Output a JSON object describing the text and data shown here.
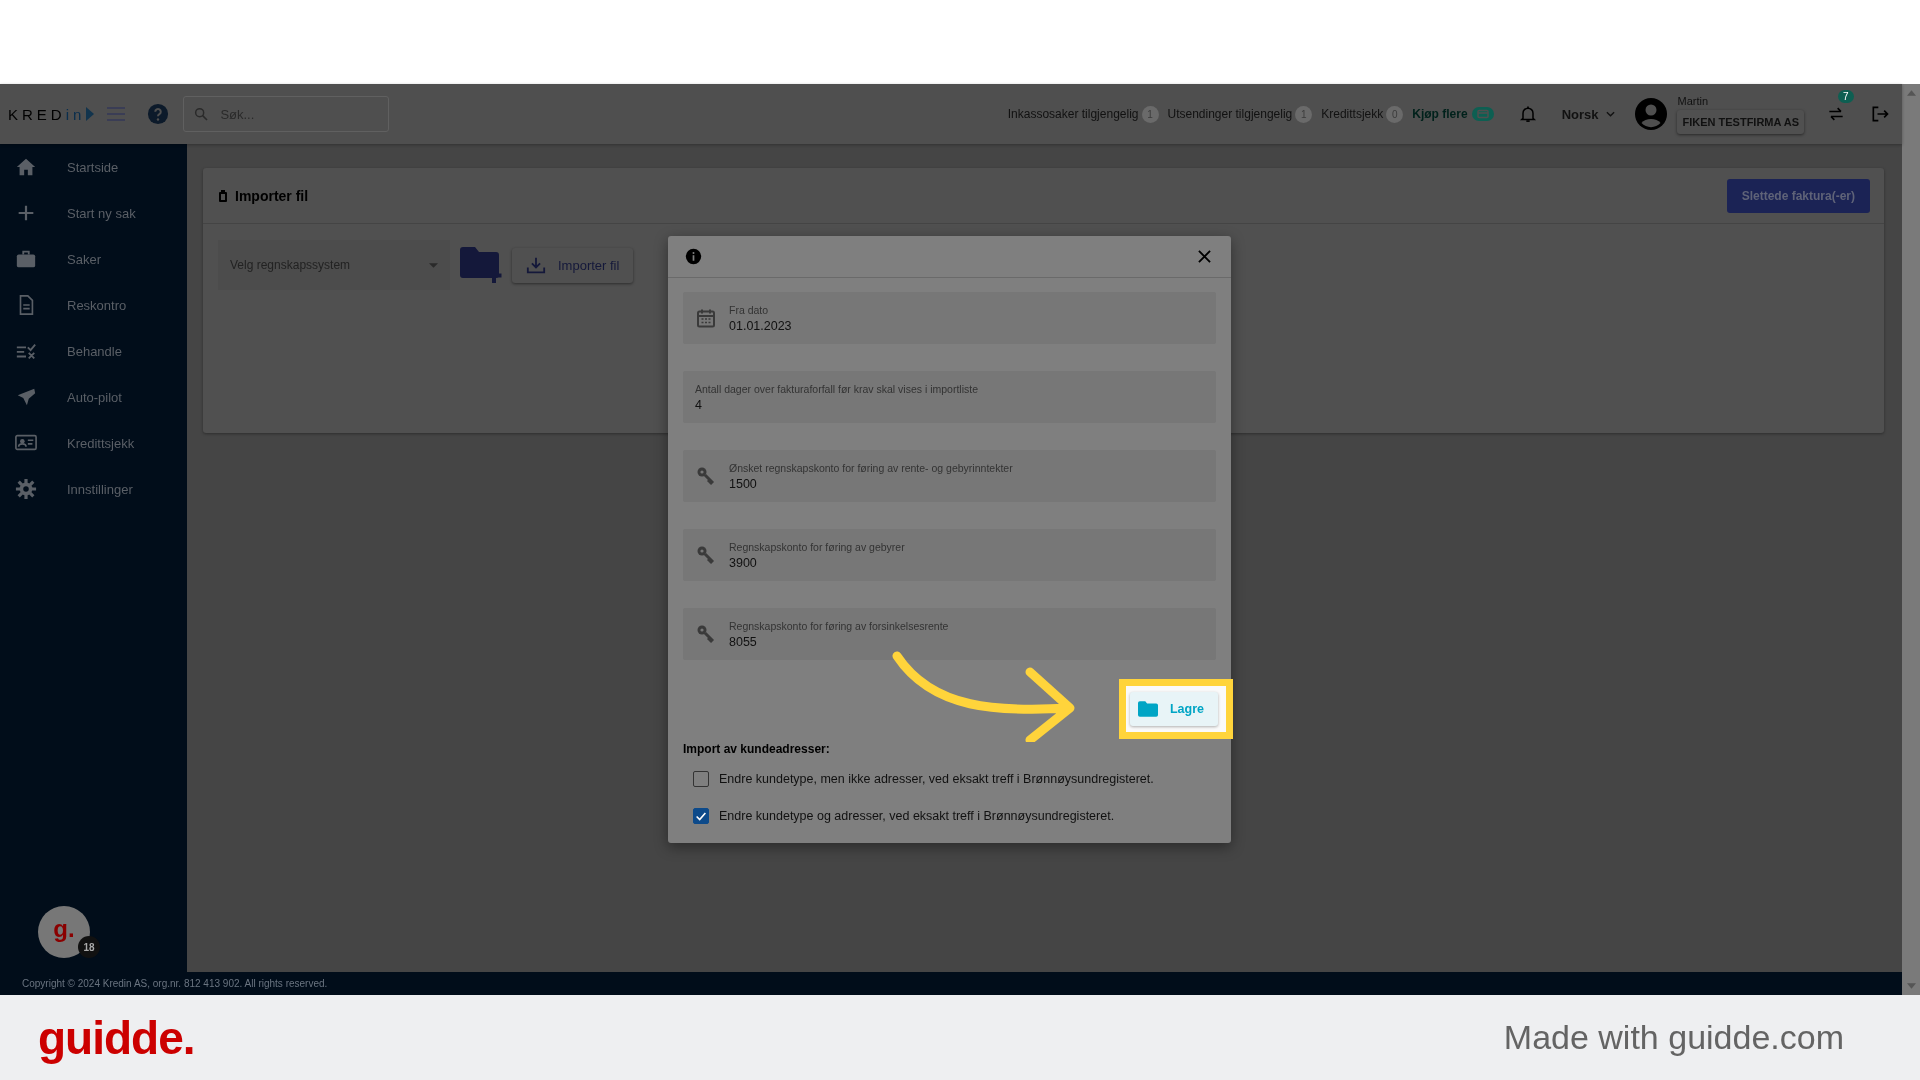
{
  "logo": {
    "text_1": "KRED",
    "text_2": "in"
  },
  "search": {
    "placeholder": "Søk..."
  },
  "counters": [
    {
      "label": "Inkassosaker tilgjengelig",
      "count": "1"
    },
    {
      "label": "Utsendinger tilgjengelig",
      "count": "1"
    },
    {
      "label": "Kredittsjekk",
      "count": "0"
    }
  ],
  "buy_link": "Kjøp flere",
  "language": "Norsk",
  "user": {
    "name": "Martin",
    "company": "FIKEN TESTFIRMA AS"
  },
  "switch_badge": "7",
  "sidebar": {
    "items": [
      {
        "label": "Startside"
      },
      {
        "label": "Start ny sak"
      },
      {
        "label": "Saker"
      },
      {
        "label": "Reskontro"
      },
      {
        "label": "Behandle"
      },
      {
        "label": "Auto-pilot"
      },
      {
        "label": "Kredittsjekk"
      },
      {
        "label": "Innstillinger"
      }
    ]
  },
  "assistant": {
    "initial": "g.",
    "count": "18"
  },
  "page": {
    "title": "Importer fil",
    "deleted_button": "Slettede faktura(-er)",
    "select": {
      "placeholder": "Velg regnskapssystem"
    },
    "import_button": "Importer fil"
  },
  "dialog": {
    "fields": [
      {
        "kind": "date",
        "label": "Fra dato",
        "value": "01.01.2023"
      },
      {
        "kind": "plain",
        "label": "Antall dager over fakturaforfall før krav skal vises i importliste",
        "value": "4"
      },
      {
        "kind": "account",
        "label": "Ønsket regnskapskonto for føring av rente- og gebyrinntekter",
        "value": "1500"
      },
      {
        "kind": "account",
        "label": "Regnskapskonto for føring av gebyrer",
        "value": "3900"
      },
      {
        "kind": "account",
        "label": "Regnskapskonto for føring av forsinkelsesrente",
        "value": "8055"
      }
    ],
    "save_button": "Lagre",
    "section_title": "Import av kundeadresser:",
    "options": [
      {
        "label": "Endre kundetype, men ikke adresser, ved eksakt treff i Brønnøysundregisteret.",
        "checked": false
      },
      {
        "label": "Endre kundetype og adresser, ved eksakt treff i Brønnøysundregisteret.",
        "checked": true
      }
    ]
  },
  "footer": {
    "copyright": "Copyright © 2024 Kredin AS, org.nr. 812 413 902. All rights reserved."
  },
  "guidde": {
    "logo": "guidde.",
    "credit": "Made with guidde.com"
  }
}
